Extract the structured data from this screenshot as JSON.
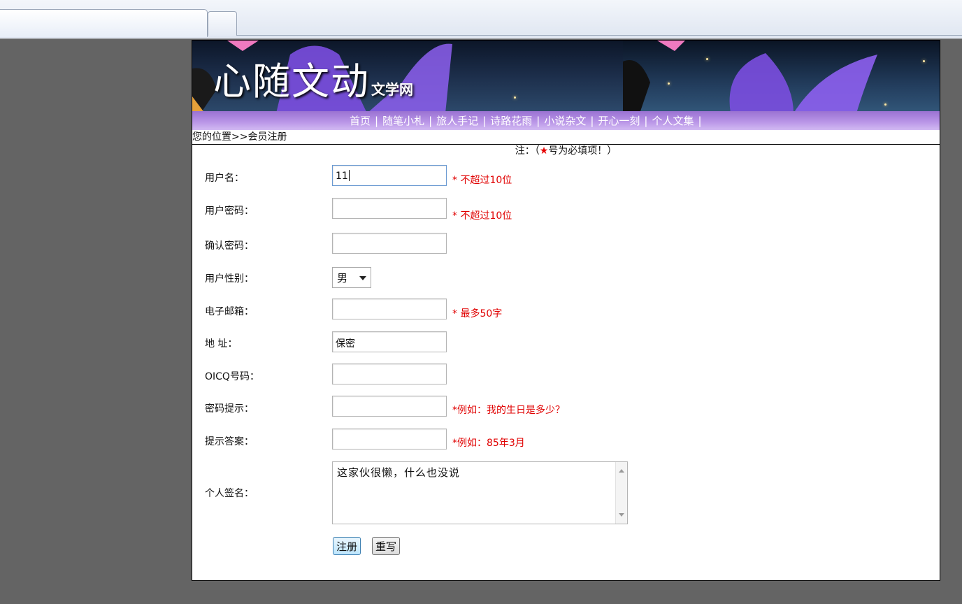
{
  "site": {
    "title_big": "心随文动",
    "title_small": "文学网"
  },
  "nav": {
    "items": [
      "首页",
      "随笔小札",
      "旅人手记",
      "诗路花雨",
      "小说杂文",
      "开心一刻",
      "个人文集"
    ],
    "separator": "|"
  },
  "breadcrumb": "您的位置>>会员注册",
  "note": {
    "prefix": "注：（",
    "star": "★",
    "suffix": "号为必填项！）"
  },
  "form": {
    "username": {
      "label": "用户名：",
      "value": "11",
      "hint": "* 不超过10位"
    },
    "password": {
      "label": "用户密码：",
      "value": "",
      "hint": "* 不超过10位"
    },
    "confirm": {
      "label": "确认密码：",
      "value": ""
    },
    "gender": {
      "label": "用户性别：",
      "value": "男"
    },
    "email": {
      "label": "电子邮箱：",
      "value": "",
      "hint": "* 最多50字"
    },
    "address": {
      "label": "地 址：",
      "value": "保密"
    },
    "oicq": {
      "label": "OICQ号码：",
      "value": ""
    },
    "pw_hint": {
      "label": "密码提示：",
      "value": "",
      "hint": "*例如：我的生日是多少？"
    },
    "pw_answer": {
      "label": "提示答案：",
      "value": "",
      "hint": "*例如：85年3月"
    },
    "signature": {
      "label": "个人签名：",
      "value": "这家伙很懒，什么也没说"
    }
  },
  "buttons": {
    "submit": "注册",
    "reset": "重写"
  },
  "colors": {
    "hint_red": "#e00000",
    "nav_purple": "#b894e6",
    "page_bg": "#646464"
  }
}
